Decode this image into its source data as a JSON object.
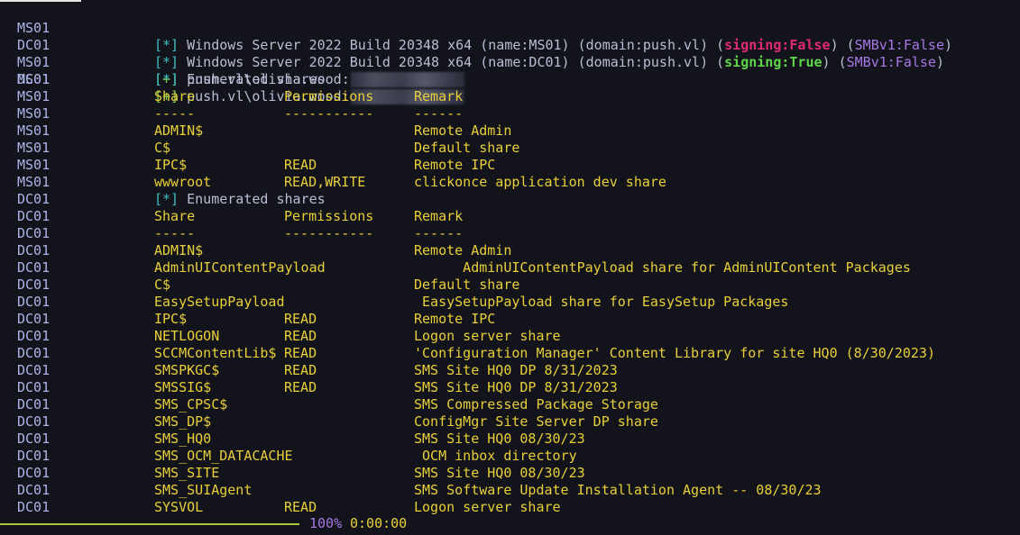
{
  "header_lines": [
    {
      "host": "MS01",
      "prefix": "[*]",
      "text": "Windows Server 2022 Build 20348 x64 (name:MS01) (domain:push.vl) (",
      "signing": "signing:False",
      "signing_ok": false,
      "mid": ") (",
      "smb": "SMBv1:False",
      "end": ")"
    },
    {
      "host": "DC01",
      "prefix": "[*]",
      "text": "Windows Server 2022 Build 20348 x64 (name:DC01) (domain:push.vl) (",
      "signing": "signing:True",
      "signing_ok": true,
      "mid": ") (",
      "smb": "SMBv1:False",
      "end": ")"
    }
  ],
  "auth_lines": [
    {
      "host": "MS01",
      "prefix": "[+]",
      "text": "push.vl\\olivia.wood:"
    },
    {
      "host": "DC01",
      "prefix": "[+]",
      "text": "push.vl\\olivia.wood:"
    }
  ],
  "ms01": {
    "host": "MS01",
    "enum_prefix": "[*]",
    "enum_text": "Enumerated shares",
    "headers": [
      "Share",
      "Permissions",
      "Remark"
    ],
    "separators": [
      "-----",
      "-----------",
      "------"
    ],
    "rows": [
      {
        "share": "ADMIN$",
        "perm": "",
        "remark": "Remote Admin"
      },
      {
        "share": "C$",
        "perm": "",
        "remark": "Default share"
      },
      {
        "share": "IPC$",
        "perm": "READ",
        "remark": "Remote IPC"
      },
      {
        "share": "wwwroot",
        "perm": "READ,WRITE",
        "remark": "clickonce application dev share"
      }
    ]
  },
  "dc01": {
    "host": "DC01",
    "enum_prefix": "[*]",
    "enum_text": "Enumerated shares",
    "headers": [
      "Share",
      "Permissions",
      "Remark"
    ],
    "separators": [
      "-----",
      "-----------",
      "------"
    ],
    "rows": [
      {
        "share": "ADMIN$",
        "perm": "",
        "remark": "Remote Admin"
      },
      {
        "share": "AdminUIContentPayload",
        "perm": "",
        "remark": "      AdminUIContentPayload share for AdminUIContent Packages"
      },
      {
        "share": "C$",
        "perm": "",
        "remark": "Default share"
      },
      {
        "share": "EasySetupPayload",
        "perm": "",
        "remark": " EasySetupPayload share for EasySetup Packages"
      },
      {
        "share": "IPC$",
        "perm": "READ",
        "remark": "Remote IPC"
      },
      {
        "share": "NETLOGON",
        "perm": "READ",
        "remark": "Logon server share"
      },
      {
        "share": "SCCMContentLib$",
        "perm": "READ",
        "remark": "'Configuration Manager' Content Library for site HQ0 (8/30/2023)"
      },
      {
        "share": "SMSPKGC$",
        "perm": "READ",
        "remark": "SMS Site HQ0 DP 8/31/2023"
      },
      {
        "share": "SMSSIG$",
        "perm": "READ",
        "remark": "SMS Site HQ0 DP 8/31/2023"
      },
      {
        "share": "SMS_CPSC$",
        "perm": "",
        "remark": "SMS Compressed Package Storage"
      },
      {
        "share": "SMS_DP$",
        "perm": "",
        "remark": "ConfigMgr Site Server DP share"
      },
      {
        "share": "SMS_HQ0",
        "perm": "",
        "remark": "SMS Site HQ0 08/30/23"
      },
      {
        "share": "SMS_OCM_DATACACHE",
        "perm": "",
        "remark": " OCM inbox directory"
      },
      {
        "share": "SMS_SITE",
        "perm": "",
        "remark": "SMS Site HQ0 08/30/23"
      },
      {
        "share": "SMS_SUIAgent",
        "perm": "",
        "remark": "SMS Software Update Installation Agent -- 08/30/23"
      },
      {
        "share": "SYSVOL",
        "perm": "READ",
        "remark": "Logon server share"
      }
    ]
  },
  "progress": {
    "percent": 100,
    "percent_label": "100%",
    "elapsed": "0:00:00"
  },
  "colors": {
    "background": "#13141b",
    "host": "#aab4e6",
    "table": "#e8cf3a",
    "info": "#3fbfc7",
    "success": "#7fd14a",
    "signing_false": "#e02a72",
    "signing_true": "#5fd34a",
    "smbv1": "#a777e6"
  }
}
